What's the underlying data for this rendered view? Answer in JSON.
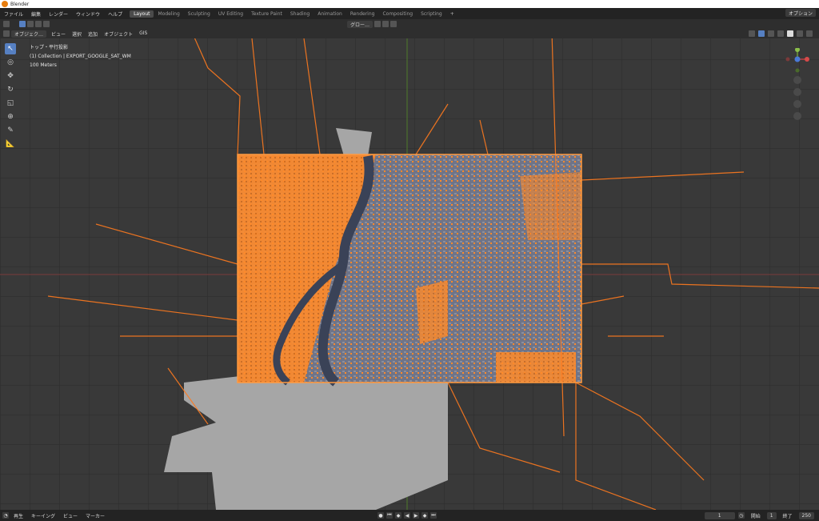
{
  "window": {
    "title": "Blender"
  },
  "menu": [
    "ファイル",
    "編集",
    "レンダー",
    "ウィンドウ",
    "ヘルプ"
  ],
  "workspaces": [
    "Layout",
    "Modeling",
    "Sculpting",
    "UV Editing",
    "Texture Paint",
    "Shading",
    "Animation",
    "Rendering",
    "Compositing",
    "Scripting",
    "+"
  ],
  "active_workspace": "Layout",
  "scene_options": {
    "label": "オプション"
  },
  "viewport_header": {
    "mode": "オブジェク…",
    "menus": [
      "ビュー",
      "選択",
      "追加",
      "オブジェクト",
      "GIS"
    ],
    "orientation": "グロー…"
  },
  "overlay": {
    "view_name": "トップ・平行投影",
    "collection": "(1) Collection | EXPORT_GOOGLE_SAT_WM",
    "scale": "100 Meters"
  },
  "timeline": {
    "mode": "再生",
    "keying": "キーイング",
    "view": "ビュー",
    "marker": "マーカー",
    "current_frame": "1",
    "start_label": "開始",
    "start": "1",
    "end_label": "終了",
    "end": "250"
  },
  "colors": {
    "accent": "#e87d0d",
    "road": "#ff8a2a",
    "viewport": "#393939",
    "land": "#a6a6a6",
    "active": "#5680c2"
  }
}
